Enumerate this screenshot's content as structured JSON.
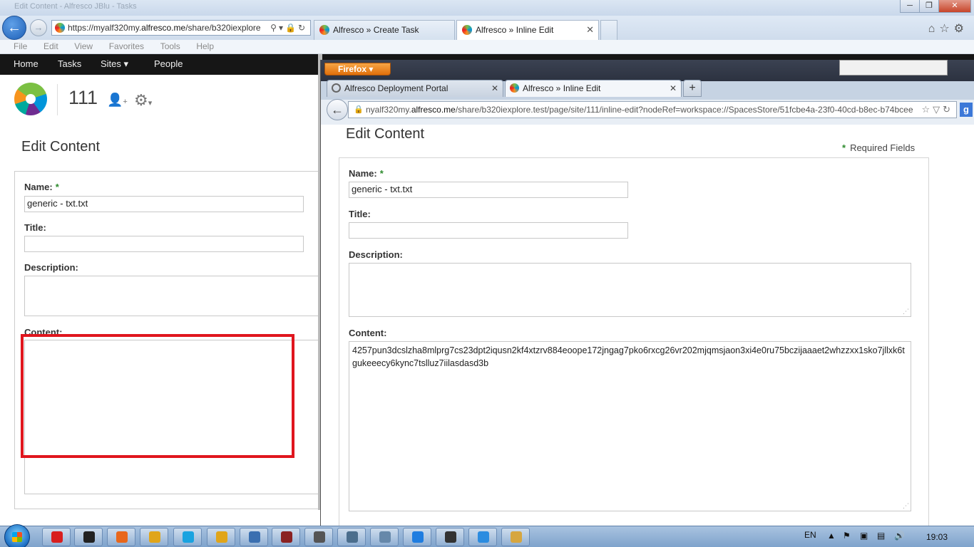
{
  "ie": {
    "title_faint": "Edit Content - Alfresco JBlu - Tasks",
    "address": {
      "prefix": "https://myalf320my.",
      "domain": "alfresco.me",
      "suffix": "/share/b320iexplore"
    },
    "tabs": [
      {
        "label": "Alfresco » Create Task",
        "active": false
      },
      {
        "label": "Alfresco » Inline Edit",
        "active": true,
        "close": "✕"
      }
    ],
    "menu": [
      "File",
      "Edit",
      "View",
      "Favorites",
      "Tools",
      "Help"
    ],
    "window_buttons": {
      "minimize": "─",
      "maximize": "❐",
      "close": "✕"
    },
    "toolbar_icons": [
      "home-icon",
      "star-icon",
      "gear-icon"
    ]
  },
  "alfresco": {
    "nav": [
      "Home",
      "Tasks",
      "Sites ▾",
      "People"
    ],
    "site_name": "111",
    "page_title": "Edit Content",
    "form": {
      "name_label": "Name:",
      "required_mark": "*",
      "name_value": "generic - txt.txt",
      "title_label": "Title:",
      "title_value": "",
      "description_label": "Description:",
      "content_label": "Content:"
    }
  },
  "firefox": {
    "menu_button": "Firefox ▾",
    "tabs": [
      {
        "label": "Alfresco Deployment Portal",
        "active": false,
        "close": "✕"
      },
      {
        "label": "Alfresco » Inline Edit",
        "active": true,
        "close": "✕"
      }
    ],
    "new_tab": "+",
    "url": {
      "prefix": "nyalf320my.",
      "domain": "alfresco.me",
      "suffix": "/share/b320iexplore.test/page/site/111/inline-edit?nodeRef=workspace://SpacesStore/51fcbe4a-23f0-40cd-b8ec-b74bcee"
    },
    "page": {
      "title": "Edit Content",
      "required_text": "Required Fields",
      "required_mark": "*",
      "name_label": "Name:",
      "name_value": "generic - txt.txt",
      "title_label": "Title:",
      "title_value": "",
      "description_label": "Description:",
      "description_value": "",
      "content_label": "Content:",
      "content_value": "4257pun3dcslzha8mlprg7cs23dpt2iqusn2kf4xtzrv884eoope172jngag7pko6rxcg26vr202mjqmsjaon3xi4e0ru75bczijaaaet2whzzxx1sko7jllxk6tgukeeecy6kync7tslluz7iilasdasd3b"
    }
  },
  "taskbar": {
    "apps": [
      "opera",
      "terminal",
      "firefox",
      "chrome",
      "skype",
      "outlook",
      "network",
      "archive",
      "tool",
      "editor",
      "calculator",
      "browser",
      "device",
      "ie-edit",
      "explorer"
    ],
    "app_colors": [
      "#d81e1e",
      "#222222",
      "#e8671b",
      "#e0a51a",
      "#1aa3e0",
      "#e0a51a",
      "#3a6fb0",
      "#8a2222",
      "#555555",
      "#4b6e8d",
      "#6688aa",
      "#1f7de0",
      "#333333",
      "#2b8ce0",
      "#d6a640"
    ],
    "language": "EN",
    "clock": "19:03"
  }
}
